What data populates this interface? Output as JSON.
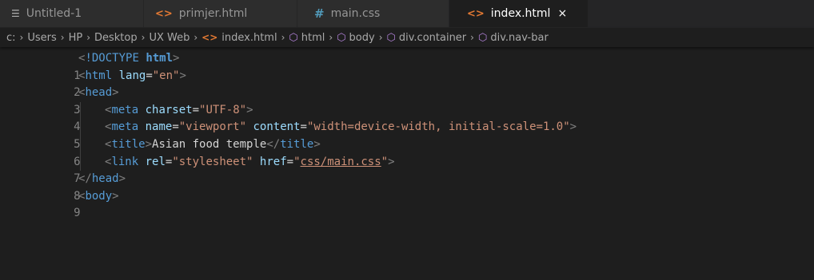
{
  "tabs": [
    {
      "label": "Untitled-1",
      "icon": "lines-icon"
    },
    {
      "label": "primjer.html",
      "icon": "html-icon"
    },
    {
      "label": "main.css",
      "icon": "css-hash-icon"
    },
    {
      "label": "index.html",
      "icon": "html-icon",
      "close": "×"
    }
  ],
  "breadcrumb": {
    "items": [
      "c:",
      "Users",
      "HP",
      "Desktop",
      "UX Web",
      "index.html",
      "html",
      "body",
      "div.container",
      "div.nav-bar"
    ],
    "separator": "›"
  },
  "editor": {
    "line_numbers": [
      "1",
      "2",
      "3",
      "4",
      "5",
      "6",
      "7",
      "8",
      "9"
    ],
    "lines": {
      "l1": {
        "open": "<",
        "kw": "!DOCTYPE",
        "name": "html",
        "close": ">"
      },
      "l2": {
        "open": "<",
        "tag": "html",
        "attr": "lang",
        "eq": "=",
        "val": "\"en\"",
        "close": ">"
      },
      "l3": {
        "open": "<",
        "tag": "head",
        "close": ">"
      },
      "l4": {
        "open": "<",
        "tag": "meta",
        "attr": "charset",
        "eq": "=",
        "val": "\"UTF-8\"",
        "close": ">"
      },
      "l5": {
        "open": "<",
        "tag": "meta",
        "attr1": "name",
        "eq": "=",
        "val1": "\"viewport\"",
        "attr2": "content",
        "val2": "\"width=device-width, initial-scale=1.0\"",
        "close": ">"
      },
      "l6": {
        "open": "<",
        "tag": "title",
        "close": ">",
        "text": "Asian food temple",
        "endopen": "</",
        "endtag": "title"
      },
      "l7": {
        "open": "<",
        "tag": "link",
        "attr1": "rel",
        "eq": "=",
        "val1": "\"stylesheet\"",
        "attr2": "href",
        "q": "\"",
        "val2": "css/main.css",
        "close": ">"
      },
      "l8": {
        "open": "</",
        "tag": "head",
        "close": ">"
      },
      "l9": {
        "open": "<",
        "tag": "body",
        "close": ">"
      }
    }
  },
  "colors": {
    "background": "#1e1e1e",
    "tag": "#569cd6",
    "attribute": "#9cdcfe",
    "string": "#ce9178",
    "punctuation": "#808080",
    "line_number": "#858585"
  }
}
